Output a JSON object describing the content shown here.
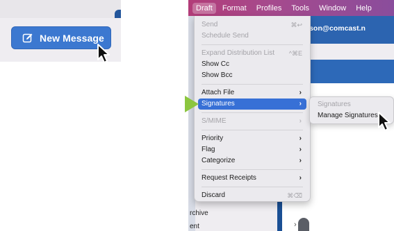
{
  "left": {
    "new_message_label": "New Message",
    "compose_icon": "compose-icon"
  },
  "menubar": {
    "items": [
      "Draft",
      "Format",
      "Profiles",
      "Tools",
      "Window",
      "Help"
    ],
    "active_item": "Draft",
    "accent": "#b23c78"
  },
  "background": {
    "email_fragment": "lsay-johnson@comcast.n",
    "archive_label": "rchive",
    "sent_label": "ent"
  },
  "draft_menu": {
    "send": {
      "label": "Send",
      "shortcut": "⌘↩"
    },
    "schedule_send": {
      "label": "Schedule Send"
    },
    "expand_distribution_list": {
      "label": "Expand Distribution List",
      "shortcut": "^⌘E"
    },
    "show_cc": {
      "label": "Show Cc"
    },
    "show_bcc": {
      "label": "Show Bcc"
    },
    "attach_file": {
      "label": "Attach File",
      "arrow": "›"
    },
    "signatures": {
      "label": "Signatures",
      "arrow": "›"
    },
    "smime": {
      "label": "S/MIME",
      "arrow": "›"
    },
    "priority": {
      "label": "Priority",
      "arrow": "›"
    },
    "flag": {
      "label": "Flag",
      "arrow": "›"
    },
    "categorize": {
      "label": "Categorize",
      "arrow": "›"
    },
    "request_receipts": {
      "label": "Request Receipts",
      "arrow": "›"
    },
    "discard": {
      "label": "Discard",
      "shortcut": "⌘⌫"
    },
    "selected_color": "#3770d6"
  },
  "signatures_submenu": {
    "header": "Signatures",
    "manage": "Manage Signatures"
  },
  "pointer_color": "#8cc63f"
}
